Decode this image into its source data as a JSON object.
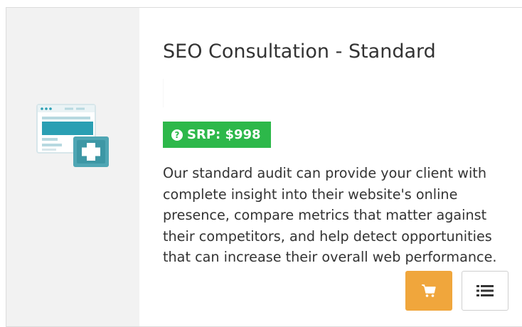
{
  "product": {
    "title": "SEO Consultation - Standard",
    "srp_label": "SRP: $998",
    "help_icon": "?",
    "description": "Our standard audit can provide your client with complete insight into their website's online presence, compare metrics that matter against their competitors, and help detect opportunities that can increase their overall web performance.",
    "icon": "website-add-icon"
  },
  "actions": {
    "cart_icon": "shopping-cart-icon",
    "details_icon": "list-icon"
  },
  "colors": {
    "srp_badge": "#2db84a",
    "cart_button": "#f0a63c",
    "icon_teal": "#2a9fb3",
    "panel_background": "#f2f2f2"
  }
}
